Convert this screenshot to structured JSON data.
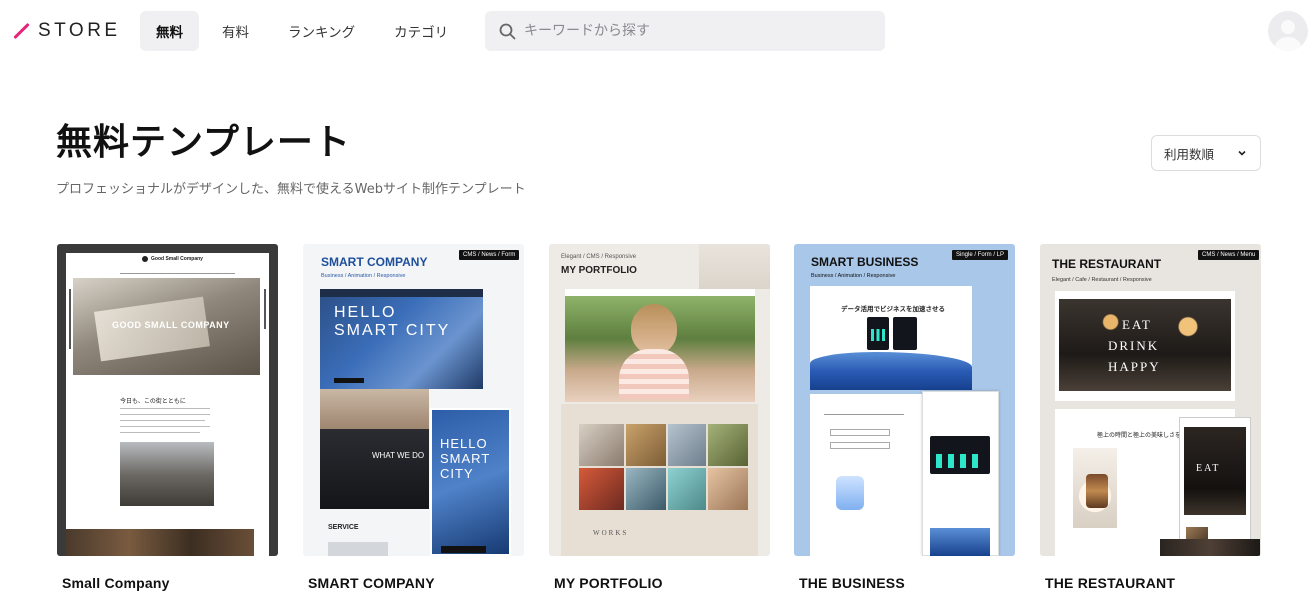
{
  "header": {
    "logo_text": "STORE",
    "nav": [
      {
        "label": "無料",
        "active": true
      },
      {
        "label": "有料",
        "active": false
      },
      {
        "label": "ランキング",
        "active": false
      },
      {
        "label": "カテゴリ",
        "active": false
      }
    ],
    "search": {
      "placeholder": "キーワードから探す",
      "value": ""
    }
  },
  "page": {
    "title": "無料テンプレート",
    "subtitle": "プロフェッショナルがデザインした、無料で使えるWebサイト制作テンプレート",
    "sort_label": "利用数順"
  },
  "cards": [
    {
      "name": "Small Company",
      "preview": {
        "brand": "Good Small Company",
        "hero": "GOOD SMALL COMPANY",
        "heading": "今日も、この街とともに"
      }
    },
    {
      "name": "SMART COMPANY",
      "preview": {
        "brand": "SMART COMPANY",
        "tagline": "Business / Animation / Responsive",
        "badge": "CMS / News / Form",
        "hero_line1": "HELLO",
        "hero_line2": "SMART CITY",
        "mobile_hero": "HELLO SMART CITY",
        "band_text": "WHAT WE DO",
        "section": "SERVICE"
      }
    },
    {
      "name": "MY PORTFOLIO",
      "preview": {
        "tagline": "Elegant / CMS / Responsive",
        "brand": "MY PORTFOLIO",
        "section": "WORKS"
      }
    },
    {
      "name": "THE BUSINESS",
      "preview": {
        "brand": "SMART BUSINESS",
        "tagline": "Business / Animation / Responsive",
        "badge": "Single / Form / LP",
        "headline": "データ活用でビジネスを加速させる"
      }
    },
    {
      "name": "THE RESTAURANT",
      "preview": {
        "brand": "THE RESTAURANT",
        "tagline": "Elegant / Cafe / Restaurant / Responsive",
        "badge": "CMS / News / Menu",
        "hero_line1": "EAT",
        "hero_line2": "DRINK",
        "hero_line3": "HAPPY",
        "heading": "極上の時間と極上の美味しさを提供"
      }
    }
  ]
}
